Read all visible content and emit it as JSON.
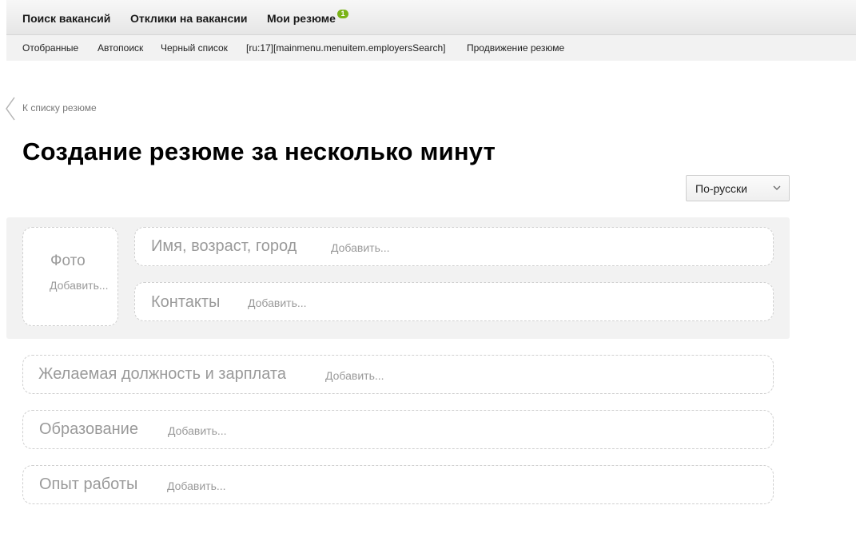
{
  "topnav": {
    "items": [
      "Поиск вакансий",
      "Отклики на вакансии",
      "Мои резюме"
    ],
    "badge": "1",
    "badge_color": "#7ab317"
  },
  "subnav": {
    "items": [
      "Отобранные",
      "Автопоиск",
      "Черный список",
      "[ru:17][mainmenu.menuitem.employersSearch]",
      "Продвижение резюме"
    ]
  },
  "back_link": "К списку резюме",
  "page_title": "Создание резюме за несколько минут",
  "language_select": {
    "selected": "По-русски"
  },
  "sections": {
    "photo": {
      "title": "Фото",
      "add": "Добавить..."
    },
    "name": {
      "title": "Имя, возраст, город",
      "add": "Добавить..."
    },
    "contacts": {
      "title": "Контакты",
      "add": "Добавить..."
    },
    "position": {
      "title": "Желаемая должность и зарплата",
      "add": "Добавить..."
    },
    "education": {
      "title": "Образование",
      "add": "Добавить..."
    },
    "experience": {
      "title": "Опыт работы",
      "add": "Добавить..."
    }
  }
}
